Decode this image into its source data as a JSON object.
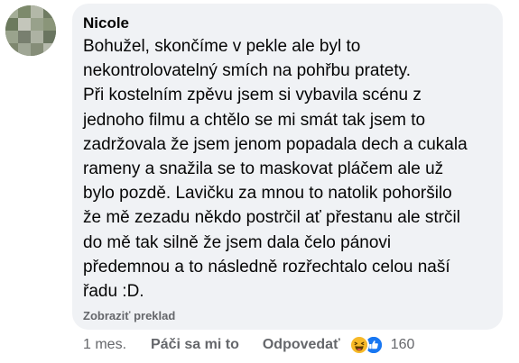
{
  "comment": {
    "author": "Nicole",
    "text_lines": [
      "Bohužel, skončíme v pekle ale byl to",
      "nekontrolovatelný smích na pohřbu pratety.",
      "Při kostelním zpěvu jsem si vybavila scénu z",
      "jednoho filmu a chtělo se mi smát tak jsem to",
      "zadržovala že jsem jenom popadala dech a cukala",
      "rameny a snažila se to maskovat pláčem ale už",
      "bylo pozdě. Lavičku za mnou to natolik pohoršilo",
      "že mě zezadu někdo postrčil ať přestanu ale strčil",
      "do mě tak silně že jsem dala čelo pánovi",
      "předemnou a to následně rozřechtalo celou naší",
      "řadu :D."
    ],
    "translate_label": "Zobraziť preklad"
  },
  "actions": {
    "time": "1 mes.",
    "like_label": "Páči sa mi to",
    "reply_label": "Odpovedať",
    "reactions": [
      "haha-icon",
      "like-icon"
    ],
    "reaction_count": "160"
  },
  "colors": {
    "bubble": "#f0f2f5",
    "text": "#050505",
    "secondary": "#65676b",
    "like_blue": "#1877f2",
    "haha_yellow": "#f7b928"
  }
}
